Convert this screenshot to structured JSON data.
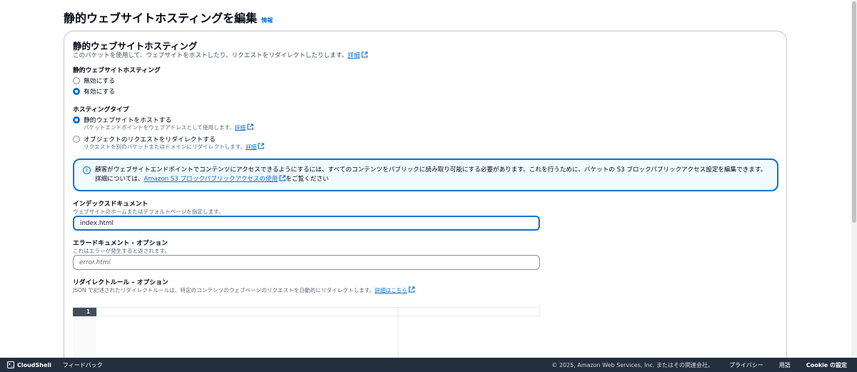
{
  "header": {
    "title": "静的ウェブサイトホスティングを編集",
    "info_link": "情報"
  },
  "panel": {
    "title": "静的ウェブサイトホスティング",
    "description": "このバケットを使用して、ウェブサイトをホストしたり、リクエストをリダイレクトしたりします。",
    "description_link": "詳細",
    "hosting_label": "静的ウェブサイトホスティング",
    "hosting_options": [
      {
        "label": "無効にする",
        "checked": false
      },
      {
        "label": "有効にする",
        "checked": true
      }
    ],
    "type_label": "ホスティングタイプ",
    "type_options": [
      {
        "label": "静的ウェブサイトをホストする",
        "sub": "バケットエンドポイントをウェブアドレスとして使用します。",
        "sub_link": "詳細",
        "checked": true
      },
      {
        "label": "オブジェクトのリクエストをリダイレクトする",
        "sub": "リクエストを別のバケットまたはドメインにリダイレクトします。",
        "sub_link": "詳細",
        "checked": false
      }
    ],
    "alert": {
      "text_1": "顧客がウェブサイトエンドポイントでコンテンツにアクセスできるようにするには、すべてのコンテンツをパブリックに読み取り可能にする必要があります。これを行うために、バケットの S3 ブロックパブリックアクセス設定を編集できま",
      "text_2": "す。詳細については、",
      "link": "Amazon S3 ブロックパブリックアクセスの使用",
      "text_3": "をご覧ください"
    },
    "index_doc": {
      "label": "インデックスドキュメント",
      "description": "ウェブサイトのホームまたはデフォルトページを指定します。",
      "value": "index.html"
    },
    "error_doc": {
      "label": "エラードキュメント - オプション",
      "description": "これはエラーが発生すると返されます。",
      "placeholder": "error.html"
    },
    "redirect_rules": {
      "label": "リダイレクトルール – オプション",
      "description": "JSON で記述されたリダイレクトルールは、特定のコンテンツのウェブページのリクエストを自動的にリダイレクトします。",
      "link": "詳細はこちら",
      "line_number": "1"
    }
  },
  "footer": {
    "cloudshell": "CloudShell",
    "feedback": "フィードバック",
    "copyright": "© 2025, Amazon Web Services, Inc. またはその関連会社。",
    "privacy": "プライバシー",
    "terms": "用語",
    "cookie": "Cookie の設定"
  },
  "colors": {
    "accent": "#0972d3",
    "footer_bg": "#232f3e",
    "alert_bg": "#f0fbff"
  }
}
